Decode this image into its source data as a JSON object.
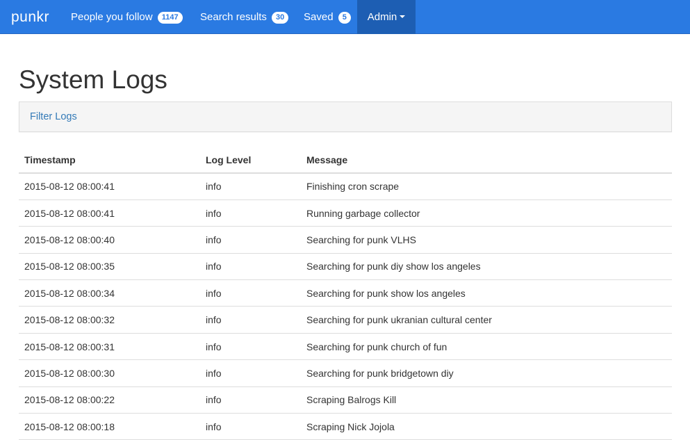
{
  "navbar": {
    "brand": "punkr",
    "items": [
      {
        "label": "People you follow",
        "badge": "1147"
      },
      {
        "label": "Search results",
        "badge": "30"
      },
      {
        "label": "Saved",
        "badge": "5"
      }
    ],
    "admin_label": "Admin",
    "colors": {
      "background": "#2a7ae2",
      "active": "#1d5eb3"
    }
  },
  "page": {
    "title": "System Logs",
    "filter_link": "Filter Logs"
  },
  "table": {
    "headers": [
      "Timestamp",
      "Log Level",
      "Message"
    ],
    "rows": [
      {
        "timestamp": "2015-08-12 08:00:41",
        "level": "info",
        "message": "Finishing cron scrape"
      },
      {
        "timestamp": "2015-08-12 08:00:41",
        "level": "info",
        "message": "Running garbage collector"
      },
      {
        "timestamp": "2015-08-12 08:00:40",
        "level": "info",
        "message": "Searching for punk VLHS"
      },
      {
        "timestamp": "2015-08-12 08:00:35",
        "level": "info",
        "message": "Searching for punk diy show los angeles"
      },
      {
        "timestamp": "2015-08-12 08:00:34",
        "level": "info",
        "message": "Searching for punk show los angeles"
      },
      {
        "timestamp": "2015-08-12 08:00:32",
        "level": "info",
        "message": "Searching for punk ukranian cultural center"
      },
      {
        "timestamp": "2015-08-12 08:00:31",
        "level": "info",
        "message": "Searching for punk church of fun"
      },
      {
        "timestamp": "2015-08-12 08:00:30",
        "level": "info",
        "message": "Searching for punk bridgetown diy"
      },
      {
        "timestamp": "2015-08-12 08:00:22",
        "level": "info",
        "message": "Scraping Balrogs Kill"
      },
      {
        "timestamp": "2015-08-12 08:00:18",
        "level": "info",
        "message": "Scraping Nick Jojola"
      }
    ]
  }
}
